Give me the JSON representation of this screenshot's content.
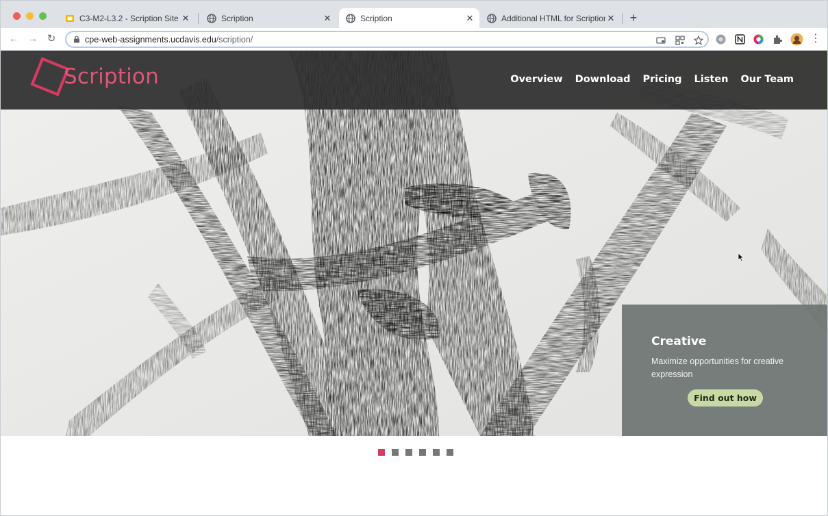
{
  "browser": {
    "tabs": [
      {
        "title": "C3-M2-L3.2 - Scription Site - ",
        "favicon": "slides-icon",
        "active": false
      },
      {
        "title": "Scription",
        "favicon": "globe-icon",
        "active": false
      },
      {
        "title": "Scription",
        "favicon": "globe-icon",
        "active": true
      },
      {
        "title": "Additional HTML for Scription",
        "favicon": "globe-icon",
        "active": false
      }
    ],
    "tab_close": "✕",
    "new_tab": "+",
    "url_domain": "cpe-web-assignments.ucdavis.edu",
    "url_path": "/scription/",
    "nav": {
      "back": "←",
      "forward": "→",
      "reload": "↻"
    },
    "menu": "⋮"
  },
  "site": {
    "logo_text": "Scription",
    "nav_items": [
      "Overview",
      "Download",
      "Pricing",
      "Listen",
      "Our Team"
    ],
    "slide": {
      "title": "Creative",
      "text": "Maximize opportunities for creative expression",
      "button": "Find out how"
    },
    "slide_count": 6,
    "active_slide": 1
  },
  "colors": {
    "brand": "#d93a63",
    "header_bg": "#2c2c2c",
    "button_bg": "#c9d9a6"
  }
}
